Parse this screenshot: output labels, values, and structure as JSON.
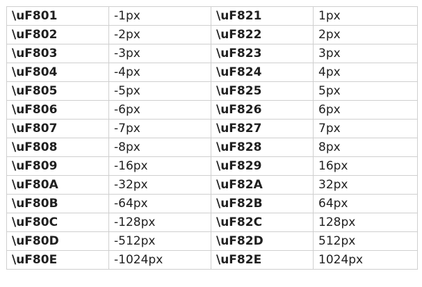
{
  "table": {
    "rows": [
      {
        "code_a": "\\uF801",
        "val_a": "-1px",
        "code_b": "\\uF821",
        "val_b": "1px"
      },
      {
        "code_a": "\\uF802",
        "val_a": "-2px",
        "code_b": "\\uF822",
        "val_b": "2px"
      },
      {
        "code_a": "\\uF803",
        "val_a": "-3px",
        "code_b": "\\uF823",
        "val_b": "3px"
      },
      {
        "code_a": "\\uF804",
        "val_a": "-4px",
        "code_b": "\\uF824",
        "val_b": "4px"
      },
      {
        "code_a": "\\uF805",
        "val_a": "-5px",
        "code_b": "\\uF825",
        "val_b": "5px"
      },
      {
        "code_a": "\\uF806",
        "val_a": "-6px",
        "code_b": "\\uF826",
        "val_b": "6px"
      },
      {
        "code_a": "\\uF807",
        "val_a": "-7px",
        "code_b": "\\uF827",
        "val_b": "7px"
      },
      {
        "code_a": "\\uF808",
        "val_a": "-8px",
        "code_b": "\\uF828",
        "val_b": "8px"
      },
      {
        "code_a": "\\uF809",
        "val_a": "-16px",
        "code_b": "\\uF829",
        "val_b": "16px"
      },
      {
        "code_a": "\\uF80A",
        "val_a": "-32px",
        "code_b": "\\uF82A",
        "val_b": "32px"
      },
      {
        "code_a": "\\uF80B",
        "val_a": "-64px",
        "code_b": "\\uF82B",
        "val_b": "64px"
      },
      {
        "code_a": "\\uF80C",
        "val_a": "-128px",
        "code_b": "\\uF82C",
        "val_b": "128px"
      },
      {
        "code_a": "\\uF80D",
        "val_a": "-512px",
        "code_b": "\\uF82D",
        "val_b": "512px"
      },
      {
        "code_a": "\\uF80E",
        "val_a": "-1024px",
        "code_b": "\\uF82E",
        "val_b": "1024px"
      }
    ]
  }
}
